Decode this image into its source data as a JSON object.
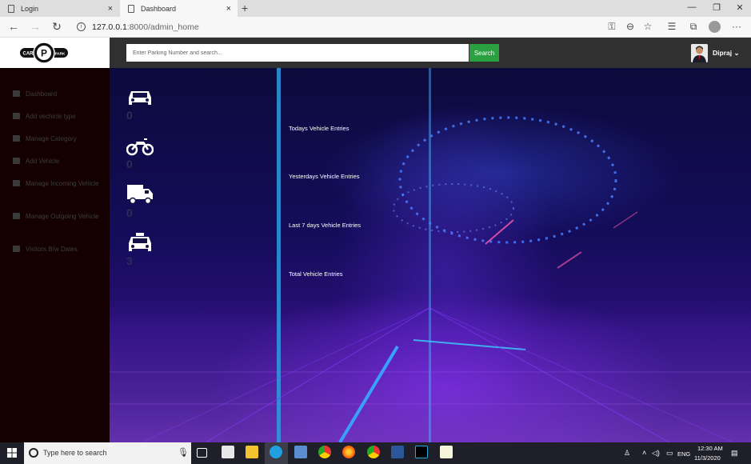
{
  "browser": {
    "tabs": [
      {
        "title": "Login",
        "close": "×"
      },
      {
        "title": "Dashboard",
        "close": "×"
      }
    ],
    "new_tab": "+",
    "window_controls": {
      "minimize": "—",
      "restore": "❐",
      "close": "✕"
    },
    "nav": {
      "back": "←",
      "forward": "→",
      "refresh": "↻"
    },
    "url_host": "127.0.0.1",
    "url_path": ":8000/admin_home",
    "tools": {
      "key": "⚿",
      "zoom": "⊖",
      "favorite": "☆",
      "favorites_bar": "☰",
      "collections": "⧉",
      "more": "···"
    }
  },
  "header": {
    "logo": {
      "left": "CAR",
      "center": "P",
      "right": "PARK"
    },
    "search_placeholder": "Enter Parking Number and search...",
    "search_button": "Search",
    "user_name": "Dipraj",
    "user_caret": "⌄"
  },
  "sidebar": {
    "items": [
      {
        "label": "Dashboard",
        "icon": "monitor-icon"
      },
      {
        "label": "Add vechicle type",
        "icon": "list-icon"
      },
      {
        "label": "Manage Category",
        "icon": "menu-icon"
      },
      {
        "label": "Add Vehicle",
        "icon": "car-icon"
      },
      {
        "label": "Manage Incoming Vehicle",
        "icon": "car-icon"
      },
      {
        "label": "Manage Outgoing Vehicle",
        "icon": "car-icon"
      },
      {
        "label": "Visitors B/w Dates",
        "icon": "users-icon"
      }
    ]
  },
  "stats": [
    {
      "icon": "car-icon",
      "count": "0",
      "label": "Todays Vehicle Entries"
    },
    {
      "icon": "motorcycle-icon",
      "count": "0",
      "label": "Yesterdays Vehicle Entries"
    },
    {
      "icon": "truck-icon",
      "count": "0",
      "label": "Last 7 days Vehicle Entries"
    },
    {
      "icon": "taxi-icon",
      "count": "3",
      "label": "Total Vehicle Entries"
    }
  ],
  "taskbar": {
    "search_text": "Type here to search",
    "mic": "🎙",
    "lang": "ENG",
    "time": "12:30 AM",
    "date": "11/3/2020",
    "apps": [
      "task-view-icon",
      "store-icon",
      "file-explorer-icon",
      "edge-icon",
      "mail-icon",
      "chrome-icon",
      "firefox-icon",
      "chrome-profile-icon",
      "word-icon",
      "pycharm-icon",
      "notepad-icon"
    ]
  },
  "colors": {
    "accent_green": "#2aa041",
    "sidebar_bg": "#140000",
    "topbar_bg": "#303030"
  }
}
